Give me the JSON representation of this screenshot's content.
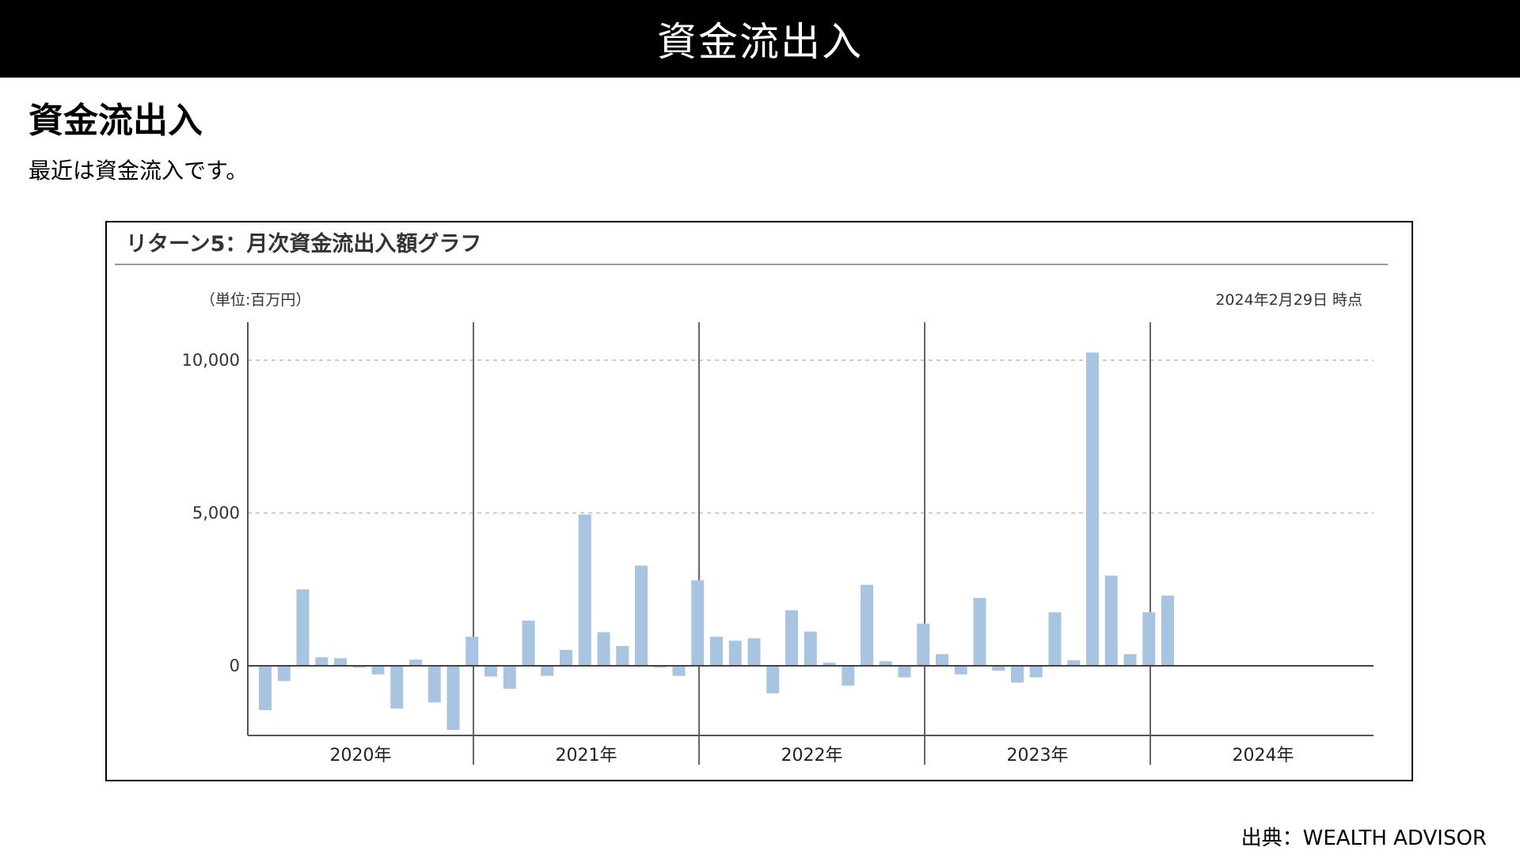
{
  "header": {
    "title": "資金流出入"
  },
  "slide": {
    "heading": "資金流出入",
    "text": "最近は資金流入です。"
  },
  "source": "出典：WEALTH ADVISOR",
  "colors": {
    "bar": "#a8c4e0",
    "header_bg": "#000000"
  },
  "chart_data": {
    "type": "bar",
    "title": "リターン5：月次資金流出入額グラフ",
    "unit": "（単位:百万円）",
    "as_of": "2024年2月29日 時点",
    "ylim": [
      -2400,
      11000
    ],
    "yticks": [
      0,
      5000,
      10000
    ],
    "ytick_labels": [
      "0",
      "5,000",
      "10,000"
    ],
    "grid": "horizontal dashed at 5,000 and 10,000",
    "years": [
      "2020年",
      "2021年",
      "2022年",
      "2023年",
      "2024年"
    ],
    "series": [
      {
        "values": [
          -1450,
          -500,
          2500,
          280,
          250,
          -60,
          -280,
          -1400,
          200,
          -1200,
          -2100,
          950,
          -350,
          -750,
          1480,
          -330,
          520,
          4950,
          1100,
          650,
          3280,
          -60,
          -330,
          2800,
          950,
          820,
          900,
          -900,
          1820,
          1120,
          100,
          -650,
          2650,
          150,
          -380,
          1380,
          380,
          -280,
          2220,
          -160,
          -550,
          -380,
          1750,
          180,
          10250,
          2950,
          380,
          1750,
          2300
        ]
      }
    ]
  }
}
